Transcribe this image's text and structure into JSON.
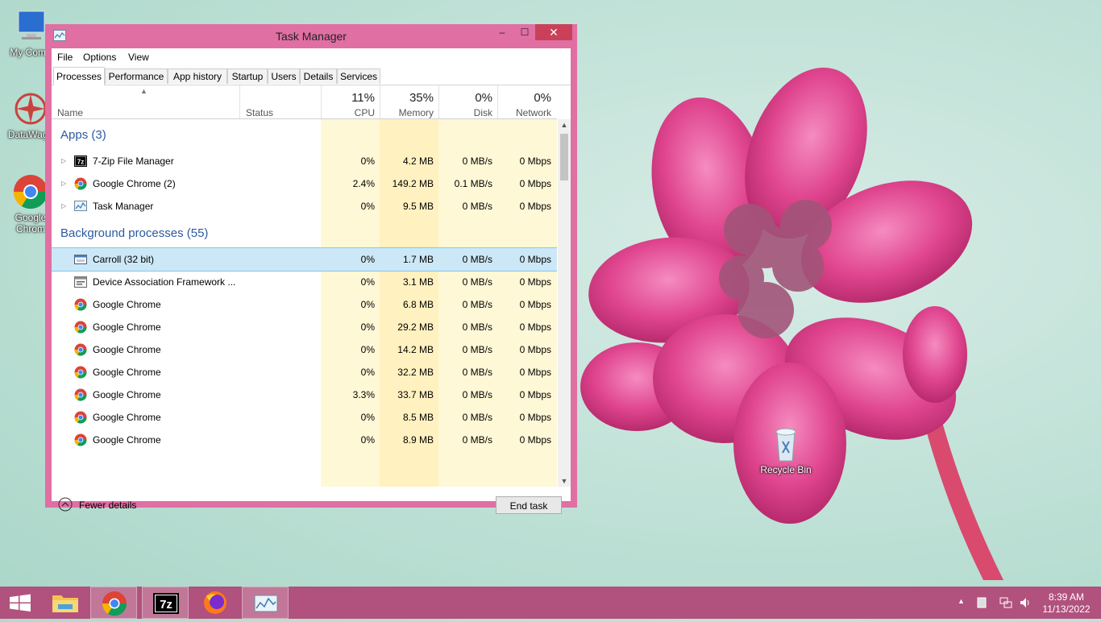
{
  "window": {
    "title": "Task Manager",
    "minimize": "–",
    "maximize": "☐",
    "close": "✕"
  },
  "menu": [
    "File",
    "Options",
    "View"
  ],
  "tabs": [
    "Processes",
    "Performance",
    "App history",
    "Startup",
    "Users",
    "Details",
    "Services"
  ],
  "columns": {
    "name": "Name",
    "status": "Status",
    "cpu": {
      "pct": "11%",
      "label": "CPU"
    },
    "memory": {
      "pct": "35%",
      "label": "Memory"
    },
    "disk": {
      "pct": "0%",
      "label": "Disk"
    },
    "network": {
      "pct": "0%",
      "label": "Network"
    }
  },
  "groups": {
    "apps": "Apps (3)",
    "background": "Background processes (55)"
  },
  "apps": [
    {
      "name": "7-Zip File Manager",
      "icon": "7zip-icon",
      "cpu": "0%",
      "memory": "4.2 MB",
      "disk": "0 MB/s",
      "network": "0 Mbps"
    },
    {
      "name": "Google Chrome (2)",
      "icon": "chrome-icon",
      "cpu": "2.4%",
      "memory": "149.2 MB",
      "disk": "0.1 MB/s",
      "network": "0 Mbps"
    },
    {
      "name": "Task Manager",
      "icon": "task-manager-icon",
      "cpu": "0%",
      "memory": "9.5 MB",
      "disk": "0 MB/s",
      "network": "0 Mbps"
    }
  ],
  "background": [
    {
      "name": "Carroll (32 bit)",
      "icon": "app-window-icon",
      "cpu": "0%",
      "memory": "1.7 MB",
      "disk": "0 MB/s",
      "network": "0 Mbps"
    },
    {
      "name": "Device Association Framework ...",
      "icon": "service-icon",
      "cpu": "0%",
      "memory": "3.1 MB",
      "disk": "0 MB/s",
      "network": "0 Mbps"
    },
    {
      "name": "Google Chrome",
      "icon": "chrome-icon",
      "cpu": "0%",
      "memory": "6.8 MB",
      "disk": "0 MB/s",
      "network": "0 Mbps"
    },
    {
      "name": "Google Chrome",
      "icon": "chrome-icon",
      "cpu": "0%",
      "memory": "29.2 MB",
      "disk": "0 MB/s",
      "network": "0 Mbps"
    },
    {
      "name": "Google Chrome",
      "icon": "chrome-icon",
      "cpu": "0%",
      "memory": "14.2 MB",
      "disk": "0 MB/s",
      "network": "0 Mbps"
    },
    {
      "name": "Google Chrome",
      "icon": "chrome-icon",
      "cpu": "0%",
      "memory": "32.2 MB",
      "disk": "0 MB/s",
      "network": "0 Mbps"
    },
    {
      "name": "Google Chrome",
      "icon": "chrome-icon",
      "cpu": "3.3%",
      "memory": "33.7 MB",
      "disk": "0 MB/s",
      "network": "0 Mbps"
    },
    {
      "name": "Google Chrome",
      "icon": "chrome-icon",
      "cpu": "0%",
      "memory": "8.5 MB",
      "disk": "0 MB/s",
      "network": "0 Mbps"
    },
    {
      "name": "Google Chrome",
      "icon": "chrome-icon",
      "cpu": "0%",
      "memory": "8.9 MB",
      "disk": "0 MB/s",
      "network": "0 Mbps"
    }
  ],
  "footer": {
    "fewer_details": "Fewer details",
    "end_task": "End task"
  },
  "desktop": {
    "icons": [
      "My Comp",
      "DataWago",
      "Google Chrom",
      "Recycle Bin"
    ]
  },
  "taskbar": {
    "time": "8:39 AM",
    "date": "11/13/2022"
  },
  "colors": {
    "accent": "#e06fa3",
    "taskbar": "#b1517d",
    "heat_light": "#fff9dc",
    "heat_mid": "#fff2c2",
    "heat_strong": "#ffe9a8",
    "selection": "#cce8f6"
  }
}
